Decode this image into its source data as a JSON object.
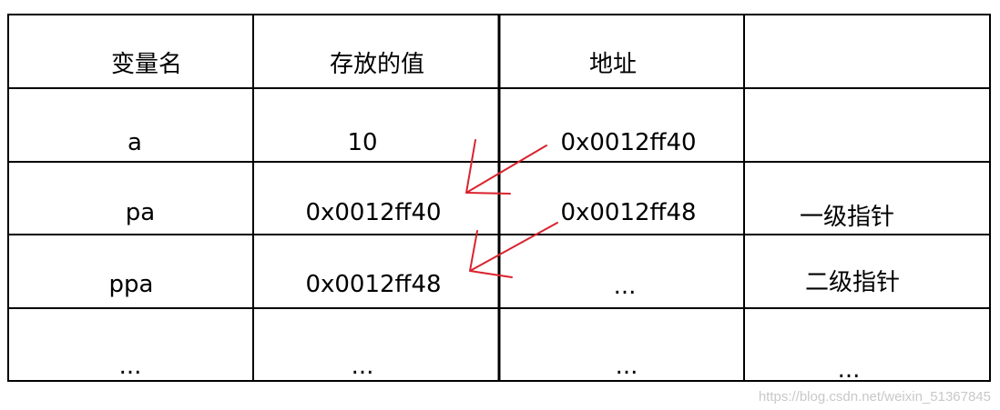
{
  "table": {
    "headers": [
      "变量名",
      "存放的值",
      "地址",
      ""
    ],
    "rows": [
      [
        "a",
        "10",
        "0x0012ff40",
        ""
      ],
      [
        "pa",
        "0x0012ff40",
        "0x0012ff48",
        "一级指针"
      ],
      [
        "ppa",
        "0x0012ff48",
        "...",
        "二级指针"
      ],
      [
        "...",
        "...",
        "...",
        "..."
      ]
    ]
  },
  "arrows": [
    {
      "from": "a.address",
      "to": "pa.value"
    },
    {
      "from": "pa.address",
      "to": "ppa.value"
    }
  ],
  "colors": {
    "grid": "#000000",
    "arrow": "#d9232e",
    "watermark": "#c8c8c8"
  },
  "watermark": "https://blog.csdn.net/weixin_51367845"
}
